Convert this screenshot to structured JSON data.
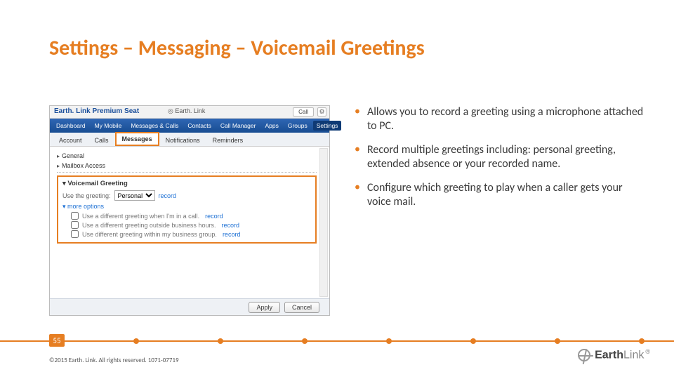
{
  "title": "Settings – Messaging – Voicemail Greetings",
  "bullets": [
    "Allows you to record a greeting using a microphone attached to PC.",
    "Record multiple greetings including:  personal greeting, extended absence or your recorded name.",
    "Configure which greeting to play when a caller gets your voice mail."
  ],
  "shot": {
    "brand": "Earth. Link Premium Seat",
    "elogo": "Earth. Link",
    "callbtn": "Call",
    "nav": [
      "Dashboard",
      "My Mobile",
      "Messages & Calls",
      "Contacts",
      "Call Manager",
      "Apps",
      "Groups"
    ],
    "nav_settings": "Settings",
    "subtabs": [
      "Account",
      "Calls",
      "Messages",
      "Notifications",
      "Reminders"
    ],
    "sections": {
      "general": "General",
      "mailbox": "Mailbox Access"
    },
    "vg": {
      "title": "Voicemail Greeting",
      "use_label": "Use the greeting:",
      "select_value": "Personal",
      "record_link": "record",
      "more": "more options",
      "opts": [
        "Use a different greeting when I'm in a call.",
        "Use a different greeting outside business hours.",
        "Use different greeting within my business group."
      ]
    },
    "apply": "Apply",
    "cancel": "Cancel"
  },
  "page_number": "55",
  "copyright": "©2015 Earth. Link. All rights reserved. 1071-07719",
  "footer_logo": {
    "bold": "Earth",
    "light": "Link"
  }
}
